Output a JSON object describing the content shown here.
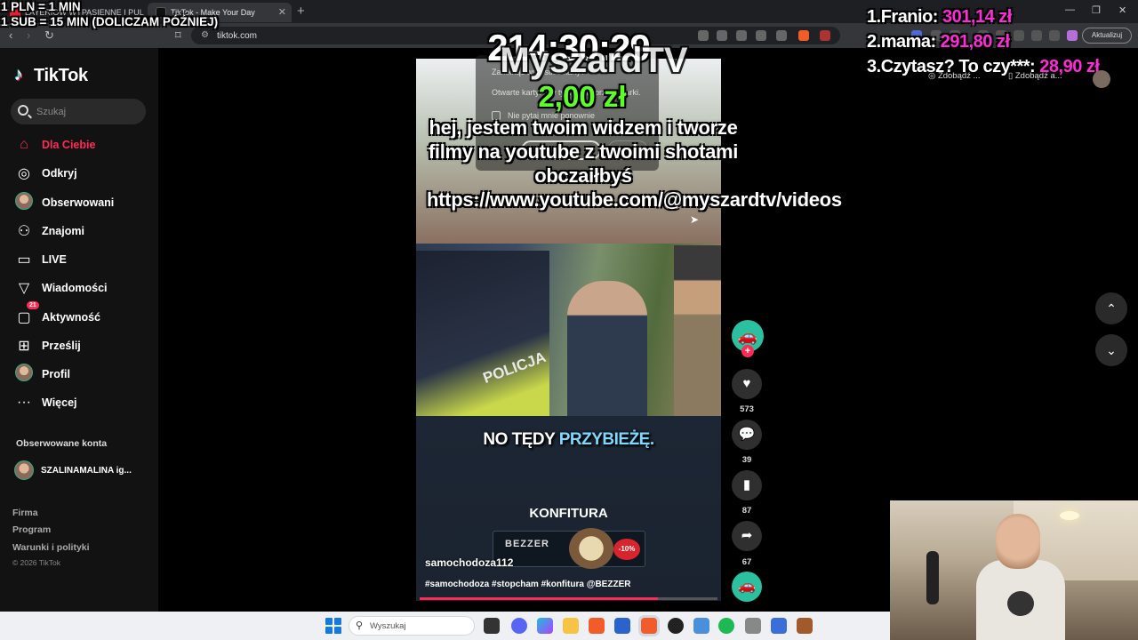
{
  "browser": {
    "tabs": [
      {
        "label": "LAYERIÓW WYPASIENNE I PULCHNYCH KOBIET"
      },
      {
        "label": "TikTok - Make Your Day"
      }
    ],
    "new_tab_icon": "+",
    "url": "tiktok.com",
    "update_label": "Aktualizuj"
  },
  "stream_rules": {
    "rule1": "1 PLN = 1 MIN",
    "rule2": "1 SUB = 15 MIN (DOLICZAM PÓŹNIEJ)"
  },
  "timer": "214:30:29",
  "donation": {
    "name": "MyszardTV",
    "amount": "2,00 zł",
    "message": "hej, jestem twoim widzem i tworze filmy na youtube z twoimi shotami obczaiłbyś https://www.youtube.com/@myszardtv/videos"
  },
  "popup": {
    "line1": "Zamknąć wszystkie karty?",
    "line2": "Otwarte karty: 2 w tym oknie przeglądarki.",
    "checkbox_label": "Nie pytaj mnie ponownie"
  },
  "leaderboard": [
    {
      "rank": "1.",
      "name": "Franio:",
      "amount": "301,14 zł"
    },
    {
      "rank": "2.",
      "name": "mama:",
      "amount": "291,80 zł"
    },
    {
      "rank": "3.",
      "name": "Czytasz? To czy***:",
      "amount": "28,90 zł"
    }
  ],
  "browser_tiles": [
    {
      "label": "Zdobądź ..."
    },
    {
      "label": "Zdobądź a..."
    }
  ],
  "tiktok": {
    "logo": "TikTok",
    "search_placeholder": "Szukaj",
    "nav": [
      {
        "label": "Dla Ciebie",
        "icon": "home-icon",
        "glyph": "⌂",
        "active": true
      },
      {
        "label": "Odkryj",
        "icon": "compass-icon",
        "glyph": "◎"
      },
      {
        "label": "Obserwowani",
        "icon": "avatar-icon",
        "glyph": ""
      },
      {
        "label": "Znajomi",
        "icon": "friends-icon",
        "glyph": "⚇"
      },
      {
        "label": "LIVE",
        "icon": "live-icon",
        "glyph": "▭"
      },
      {
        "label": "Wiadomości",
        "icon": "messages-icon",
        "glyph": "▽"
      },
      {
        "label": "Aktywność",
        "icon": "activity-icon",
        "glyph": "▢",
        "badge": "21"
      },
      {
        "label": "Prześlij",
        "icon": "upload-icon",
        "glyph": "⊞"
      },
      {
        "label": "Profil",
        "icon": "profile-icon",
        "glyph": ""
      },
      {
        "label": "Więcej",
        "icon": "more-icon",
        "glyph": "···"
      }
    ],
    "followed_title": "Obserwowane konta",
    "followed_accounts": [
      {
        "name": "SZALINAMALINA ig..."
      }
    ],
    "footer_links": [
      "Firma",
      "Program",
      "Warunki i polityki"
    ],
    "copyright": "© 2026 TikTok"
  },
  "video": {
    "police_text": "POLICJA",
    "subtitle_part1": "NO TĘDY ",
    "subtitle_part2": "PRZYBIEŻĘ.",
    "overlay_title": "KONFITURA",
    "ad_brand": "BEZZER",
    "ad_tag": "-10%",
    "author": "samochodoza112",
    "tags": "#samochodoza #stopcham #konfitura @BEZZER",
    "progress": 0.8
  },
  "actions": {
    "likes": "573",
    "comments": "39",
    "saves": "87",
    "shares": "67"
  },
  "taskbar": {
    "search_placeholder": "Wyszukaj"
  },
  "colors": {
    "accent": "#fe2c55",
    "donation_amount": "#5dff2a",
    "leaderboard_amount": "#ff2bd6"
  }
}
